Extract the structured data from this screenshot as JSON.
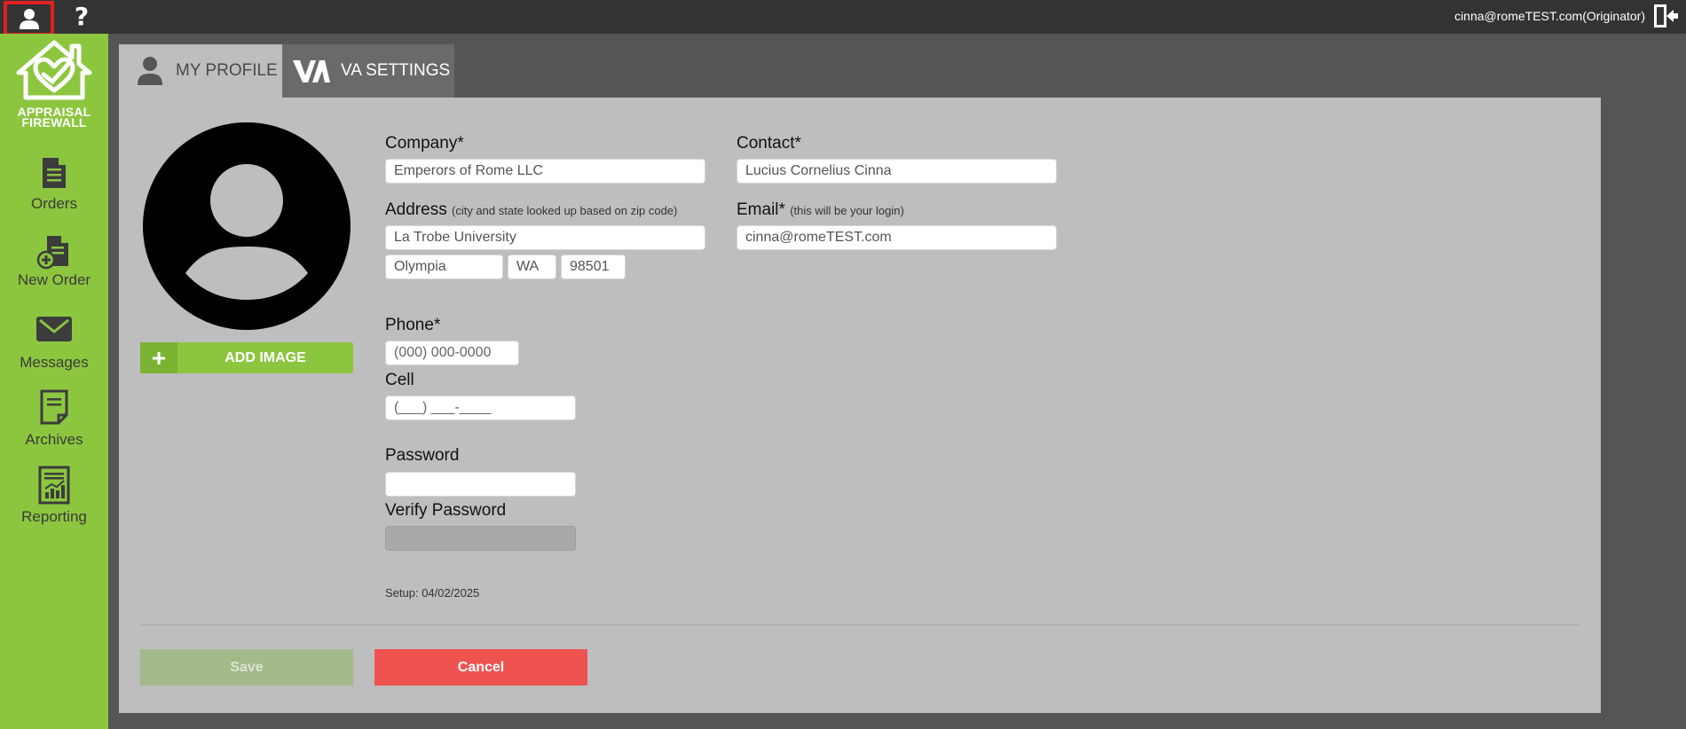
{
  "topbar": {
    "user_icon": "user-icon",
    "help_glyph": "?",
    "user_text": "cinna@romeTEST.com(Originator)",
    "logout_icon": "logout-icon"
  },
  "logo": {
    "line1": "APPRAISAL",
    "line2": "FIREWALL"
  },
  "sidebar": {
    "items": [
      {
        "label": "Orders",
        "icon": "document-icon"
      },
      {
        "label": "New Order",
        "icon": "new-document-icon"
      },
      {
        "label": "Messages",
        "icon": "envelope-icon"
      },
      {
        "label": "Archives",
        "icon": "archive-icon"
      },
      {
        "label": "Reporting",
        "icon": "report-chart-icon"
      }
    ]
  },
  "tabs": [
    {
      "label": "MY PROFILE",
      "icon": "user-icon",
      "active": true
    },
    {
      "label": "VA SETTINGS",
      "icon": "va-logo-icon",
      "active": false
    }
  ],
  "profile": {
    "add_image_label": "ADD IMAGE",
    "add_image_glyph": "+",
    "company_label": "Company*",
    "company_value": "Emperors of Rome LLC",
    "contact_label": "Contact*",
    "contact_value": "Lucius Cornelius Cinna",
    "address_label": "Address",
    "address_hint": "(city and state looked up based on zip code)",
    "address_value": "La Trobe University",
    "city_value": "Olympia",
    "state_value": "WA",
    "zip_value": "98501",
    "email_label": "Email*",
    "email_hint": "(this will be your login)",
    "email_value": "cinna@romeTEST.com",
    "phone_label": "Phone*",
    "phone_placeholder": "(000) 000-0000",
    "cell_label": "Cell",
    "cell_placeholder": "(___) ___-____",
    "password_label": "Password",
    "password_value": "",
    "verify_password_label": "Verify Password",
    "verify_password_value": "",
    "setup_text": "Setup: 04/02/2025"
  },
  "actions": {
    "save_label": "Save",
    "cancel_label": "Cancel"
  },
  "colors": {
    "sidebar_green": "#8cc63f",
    "cancel_red": "#ef5350",
    "topbar": "#333333",
    "panel": "#bebebe"
  }
}
